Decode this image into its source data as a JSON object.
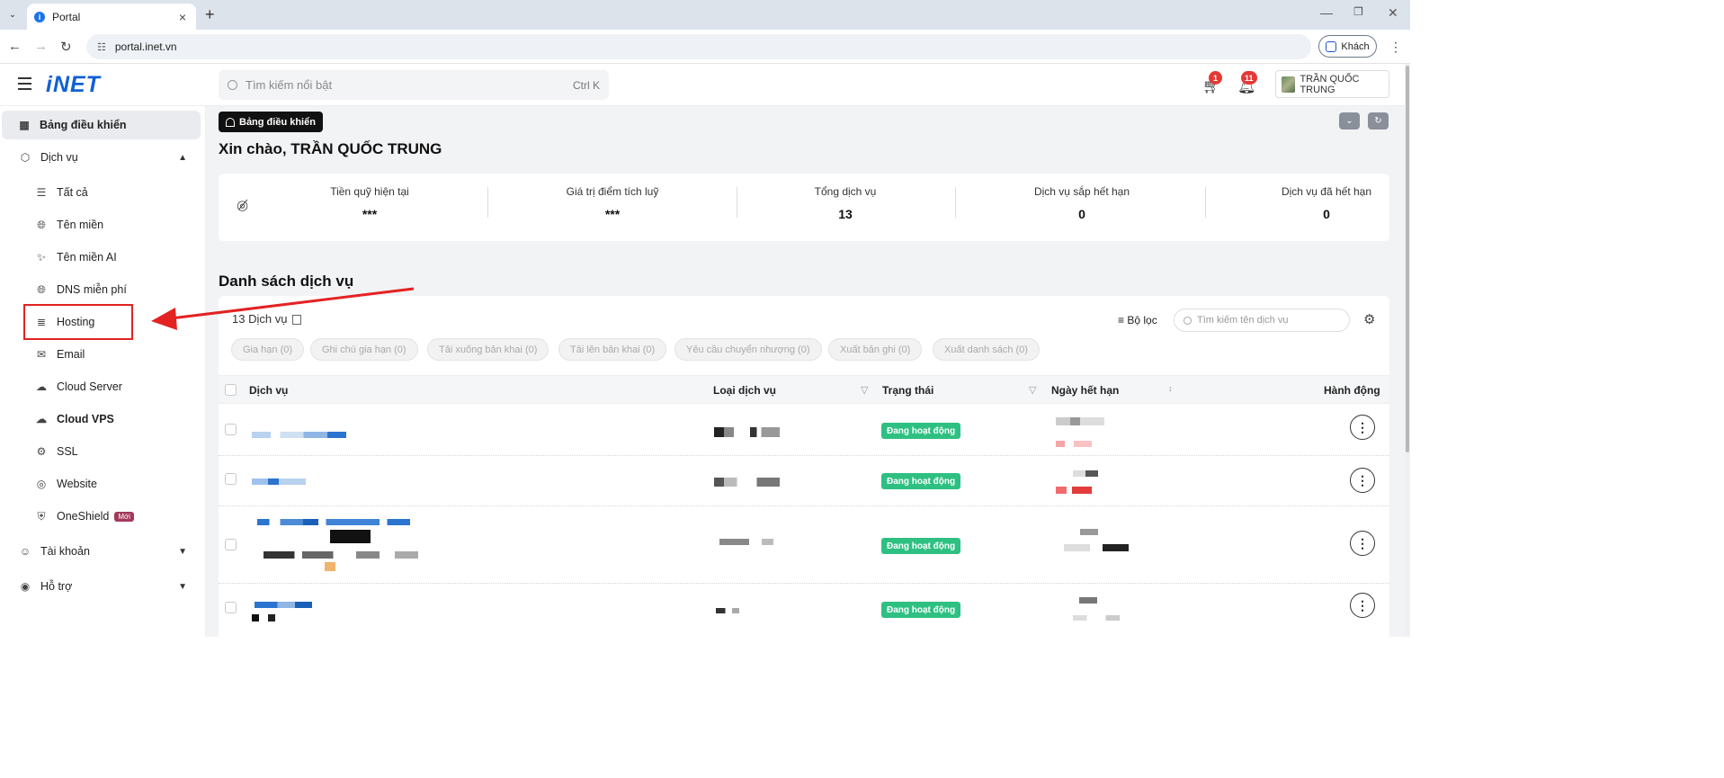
{
  "browser": {
    "tab_title": "Portal",
    "url": "portal.inet.vn",
    "profile_label": "Khách"
  },
  "header": {
    "logo": "iNET",
    "search_placeholder": "Tìm kiếm nổi bật",
    "search_shortcut": "Ctrl K",
    "cart_count": "1",
    "notification_count": "11",
    "user_name": "TRẦN QUỐC TRUNG"
  },
  "sidebar": {
    "dashboard": "Bảng điều khiển",
    "services": "Dịch vụ",
    "items": [
      {
        "label": "Tất cả",
        "icon": "list-icon"
      },
      {
        "label": "Tên miền",
        "icon": "globe-icon"
      },
      {
        "label": "Tên miền AI",
        "icon": "sparkle-icon"
      },
      {
        "label": "DNS miễn phí",
        "icon": "globe-icon"
      },
      {
        "label": "Hosting",
        "icon": "server-icon"
      },
      {
        "label": "Email",
        "icon": "mail-icon"
      },
      {
        "label": "Cloud Server",
        "icon": "cloud-icon"
      },
      {
        "label": "Cloud VPS",
        "icon": "cloud-icon"
      },
      {
        "label": "SSL",
        "icon": "ssl-icon"
      },
      {
        "label": "Website",
        "icon": "website-icon"
      },
      {
        "label": "OneShield",
        "icon": "shield-icon",
        "badge": "Mới"
      }
    ],
    "account": "Tài khoản",
    "support": "Hỗ trợ"
  },
  "main": {
    "breadcrumb": "Bảng điều khiển",
    "greeting": "Xin chào, TRẦN QUỐC TRUNG",
    "stats": [
      {
        "label": "Tiền quỹ hiện tại",
        "value": "***"
      },
      {
        "label": "Giá trị điểm tích luỹ",
        "value": "***"
      },
      {
        "label": "Tổng dịch vụ",
        "value": "13"
      },
      {
        "label": "Dịch vụ sắp hết hạn",
        "value": "0"
      },
      {
        "label": "Dịch vụ đã hết hạn",
        "value": "0"
      }
    ],
    "list_title": "Danh sách dịch vụ",
    "service_count": "13 Dịch vụ",
    "filter_label": "Bộ lọc",
    "list_search_placeholder": "Tìm kiếm tên dịch vụ",
    "bulk_actions": [
      "Gia hạn (0)",
      "Ghi chú gia hạn (0)",
      "Tải xuống bản khai (0)",
      "Tải lên bản khai (0)",
      "Yêu cầu chuyển nhượng (0)",
      "Xuất bản ghi (0)",
      "Xuất danh sách (0)"
    ],
    "columns": {
      "service": "Dịch vụ",
      "type": "Loại dịch vụ",
      "status": "Trạng thái",
      "expiry": "Ngày hết hạn",
      "actions": "Hành động"
    },
    "rows": [
      {
        "status": "Đang hoạt động"
      },
      {
        "status": "Đang hoạt động"
      },
      {
        "status": "Đang hoạt động"
      },
      {
        "status": "Đang hoạt động"
      }
    ]
  },
  "colors": {
    "brand": "#1060d6",
    "status_active": "#2ec082",
    "annotation": "#e32222"
  }
}
